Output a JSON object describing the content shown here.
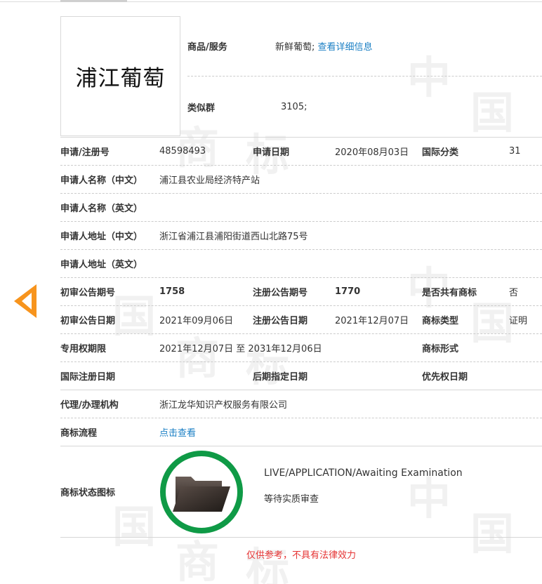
{
  "logo": {
    "text": "浦江葡萄"
  },
  "header": {
    "goods_label": "商品/服务",
    "goods_value": "新鲜葡萄;",
    "goods_link": "查看详细信息",
    "group_label": "类似群",
    "group_value": "3105;"
  },
  "fields": {
    "reg_no_label": "申请/注册号",
    "reg_no_value": "48598493",
    "app_date_label": "申请日期",
    "app_date_value": "2020年08月03日",
    "intl_class_label": "国际分类",
    "intl_class_value": "31",
    "applicant_cn_label": "申请人名称（中文）",
    "applicant_cn_value": "浦江县农业局经济特产站",
    "applicant_en_label": "申请人名称（英文）",
    "address_cn_label": "申请人地址（中文）",
    "address_cn_value": "浙江省浦江县浦阳街道西山北路75号",
    "address_en_label": "申请人地址（英文）",
    "prelim_no_label": "初审公告期号",
    "prelim_no_value": "1758",
    "reg_pub_no_label": "注册公告期号",
    "reg_pub_no_value": "1770",
    "shared_label": "是否共有商标",
    "shared_value": "否",
    "prelim_date_label": "初审公告日期",
    "prelim_date_value": "2021年09月06日",
    "reg_pub_date_label": "注册公告日期",
    "reg_pub_date_value": "2021年12月07日",
    "type_label": "商标类型",
    "type_value": "证明",
    "term_label": "专用权期限",
    "term_value": "2021年12月07日 至 2031年12月06日",
    "form_label": "商标形式",
    "intl_reg_date_label": "国际注册日期",
    "late_date_label": "后期指定日期",
    "priority_date_label": "优先权日期",
    "agent_label": "代理/办理机构",
    "agent_value": "浙江龙华知识产权服务有限公司",
    "process_label": "商标流程",
    "process_link": "点击查看",
    "status_icon_label": "商标状态图标"
  },
  "status": {
    "en": "LIVE/APPLICATION/Awaiting Examination",
    "cn": "等待实质审查",
    "ring_color": "#0f9a46"
  },
  "disclaimer": "仅供参考，不具有法律效力",
  "colors": {
    "accent_arrow": "#f7941d",
    "link": "#1a7fc4",
    "disclaimer": "#e53333"
  }
}
